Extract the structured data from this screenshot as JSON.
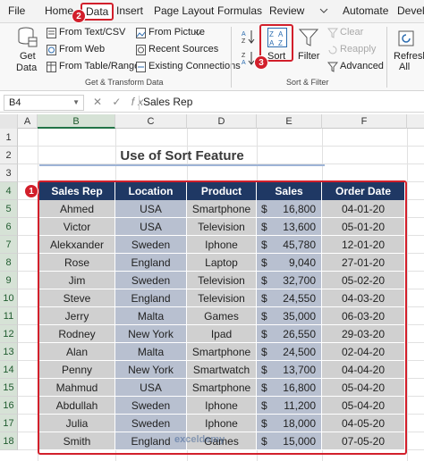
{
  "ribbon_tabs": [
    "File",
    "Home",
    "Data",
    "Insert",
    "Page Layout",
    "Formulas",
    "Review",
    "Automate",
    "Develo"
  ],
  "get_data": {
    "label1": "Get",
    "label2": "Data"
  },
  "get_transform": {
    "items": [
      "From Text/CSV",
      "From Web",
      "From Table/Range"
    ],
    "items2": [
      "From Picture",
      "Recent Sources",
      "Existing Connections"
    ],
    "title": "Get & Transform Data"
  },
  "sort_filter": {
    "sort_label": "Sort",
    "filter_label": "Filter",
    "clear_label": "Clear",
    "reapply_label": "Reapply",
    "advanced_label": "Advanced",
    "title": "Sort & Filter",
    "sort_icon_top": "A Z",
    "sort_icon_bottom": "Z A"
  },
  "refresh": {
    "label1": "Refresh",
    "label2": "All"
  },
  "formula_bar": {
    "name_box": "B4",
    "fx": "fx",
    "value": "Sales Rep"
  },
  "columns": [
    "A",
    "B",
    "C",
    "D",
    "E",
    "F"
  ],
  "rows": [
    "1",
    "2",
    "3",
    "4",
    "5",
    "6",
    "7",
    "8",
    "9",
    "10",
    "11",
    "12",
    "13",
    "14",
    "15",
    "16",
    "17",
    "18"
  ],
  "sheet_title": "Use of Sort Feature",
  "table": {
    "headers": [
      "Sales Rep",
      "Location",
      "Product",
      "Sales",
      "Order Date"
    ],
    "currency": "$",
    "rows": [
      [
        "Ahmed",
        "USA",
        "Smartphone",
        "16,800",
        "04-01-20"
      ],
      [
        "Victor",
        "USA",
        "Television",
        "13,600",
        "05-01-20"
      ],
      [
        "Alekxander",
        "Sweden",
        "Iphone",
        "45,780",
        "12-01-20"
      ],
      [
        "Rose",
        "England",
        "Laptop",
        "9,040",
        "27-01-20"
      ],
      [
        "Jim",
        "Sweden",
        "Television",
        "32,700",
        "05-02-20"
      ],
      [
        "Steve",
        "England",
        "Television",
        "24,550",
        "04-03-20"
      ],
      [
        "Jerry",
        "Malta",
        "Games",
        "35,000",
        "06-03-20"
      ],
      [
        "Rodney",
        "New York",
        "Ipad",
        "26,550",
        "29-03-20"
      ],
      [
        "Alan",
        "Malta",
        "Smartphone",
        "24,500",
        "02-04-20"
      ],
      [
        "Penny",
        "New York",
        "Smartwatch",
        "13,700",
        "04-04-20"
      ],
      [
        "Mahmud",
        "USA",
        "Smartphone",
        "16,800",
        "05-04-20"
      ],
      [
        "Abdullah",
        "Sweden",
        "Iphone",
        "11,200",
        "05-04-20"
      ],
      [
        "Julia",
        "Sweden",
        "Iphone",
        "18,000",
        "04-05-20"
      ],
      [
        "Smith",
        "England",
        "Games",
        "15,000",
        "07-05-20"
      ]
    ]
  },
  "badges": [
    "1",
    "2",
    "3"
  ],
  "watermark": "exceldemy"
}
